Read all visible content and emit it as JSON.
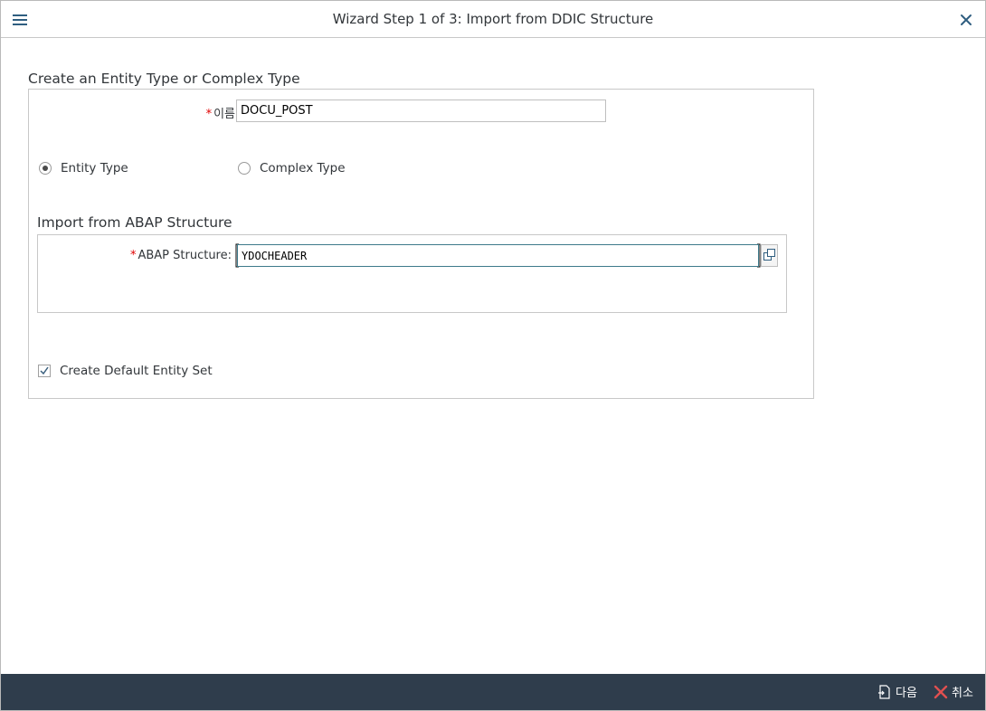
{
  "window": {
    "title": "Wizard Step 1 of 3: Import from DDIC Structure",
    "menu_icon": "hamburger-menu-icon",
    "close_icon": "close-icon"
  },
  "entity_section": {
    "title": "Create an Entity Type or Complex Type",
    "name_field": {
      "required_mark": "*",
      "label": "이름",
      "value": "DOCU_POST"
    },
    "type_options": [
      {
        "label": "Entity Type",
        "selected": true
      },
      {
        "label": "Complex Type",
        "selected": false
      }
    ],
    "create_default_entity_set": {
      "label": "Create Default Entity Set",
      "checked": true
    }
  },
  "abap_section": {
    "title": "Import from ABAP Structure",
    "structure_field": {
      "required_mark": "*",
      "label": "ABAP Structure:",
      "value": "YDOCHEADER",
      "value_help_icon": "value-help-icon"
    }
  },
  "footer": {
    "next_label": "다음",
    "next_icon": "next-step-icon",
    "cancel_label": "취소",
    "cancel_icon": "cancel-x-icon"
  },
  "colors": {
    "footer_bg": "#2f3d4c",
    "required": "#e00000",
    "focus_border": "#3d7a8a",
    "cancel_icon": "#e05050"
  }
}
